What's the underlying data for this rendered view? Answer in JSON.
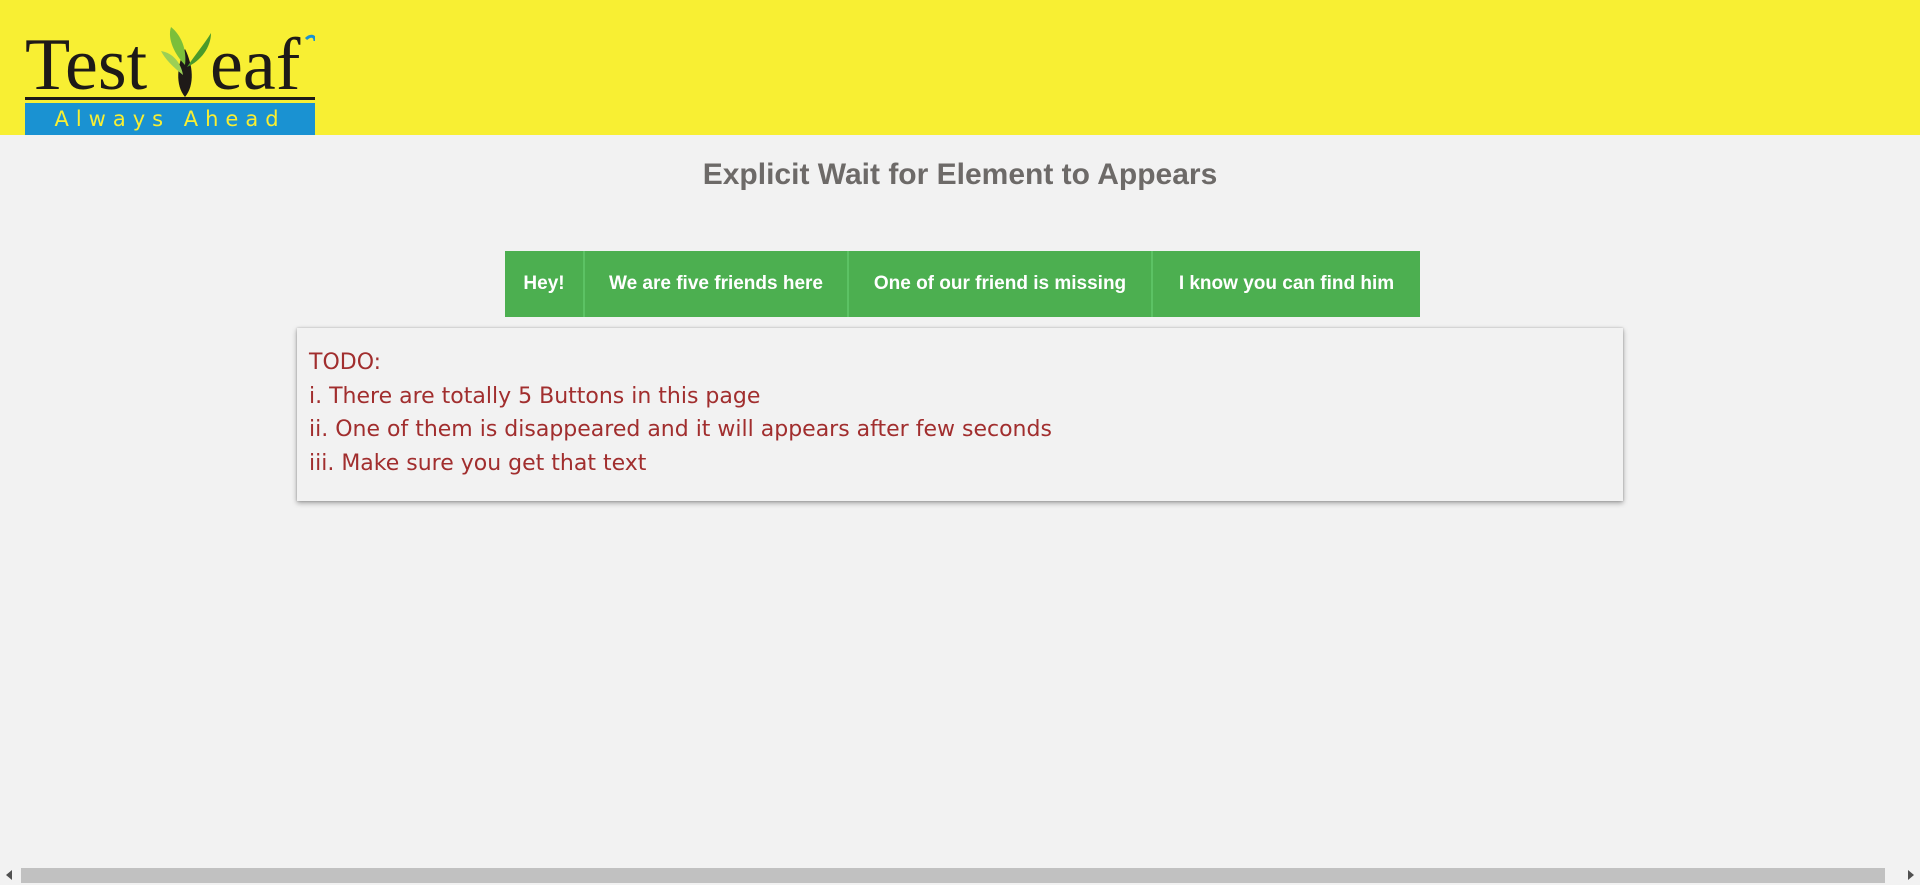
{
  "header": {
    "logo": {
      "brand": "TestLeaf",
      "tagline": "Always Ahead"
    },
    "colors": {
      "background": "#f8ef33",
      "tagline_bar": "#1a92d2"
    }
  },
  "main": {
    "title": "Explicit Wait for Element to Appears",
    "buttons": [
      {
        "label": "Hey!"
      },
      {
        "label": "We are five friends here"
      },
      {
        "label": "One of our friend is missing"
      },
      {
        "label": "I know you can find him"
      }
    ],
    "button_color": "#4caf50",
    "todo": {
      "heading": "TODO:",
      "items": [
        "i. There are totally 5 Buttons in this page",
        "ii. One of them is disappeared and it will appears after few seconds",
        "iii. Make sure you get that text"
      ],
      "text_color": "#a12e2e"
    }
  },
  "scrollbar": {
    "orientation": "horizontal"
  }
}
